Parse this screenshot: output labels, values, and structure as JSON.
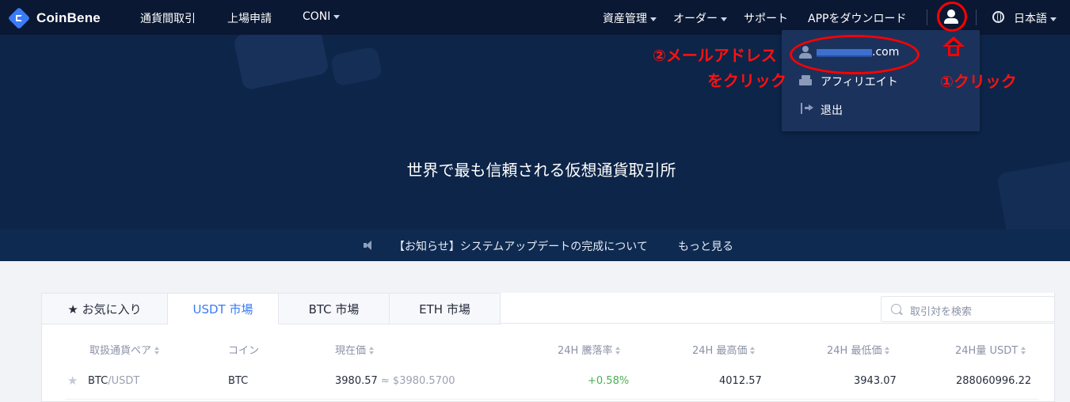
{
  "brand": {
    "name": "CoinBene"
  },
  "nav": {
    "items": [
      {
        "label": "通貨間取引",
        "dropdown": false
      },
      {
        "label": "上場申請",
        "dropdown": false
      },
      {
        "label": "CONI",
        "dropdown": true
      }
    ],
    "right": [
      {
        "label": "資産管理",
        "dropdown": true
      },
      {
        "label": "オーダー",
        "dropdown": true
      },
      {
        "label": "サポート",
        "dropdown": false
      },
      {
        "label": "APPをダウンロード",
        "dropdown": false
      }
    ],
    "language": "日本語"
  },
  "dropdown": {
    "email_suffix": ".com",
    "items": [
      {
        "label": "アフィリエイト",
        "icon": "affiliate-icon"
      },
      {
        "label": "退出",
        "icon": "logout-icon"
      }
    ]
  },
  "annotations": {
    "step1": "①クリック",
    "step2_line1": "②メールアドレス",
    "step2_line2": "をクリック",
    "color": "#ff0000"
  },
  "hero": {
    "title": "世界で最も信頼される仮想通貨取引所"
  },
  "notice": {
    "text": "【お知らせ】システムアップデートの完成について",
    "more": "もっと見る"
  },
  "market": {
    "tabs": [
      {
        "label": "★ お気に入り",
        "active": false
      },
      {
        "label": "USDT 市場",
        "active": true
      },
      {
        "label": "BTC 市場",
        "active": false
      },
      {
        "label": "ETH 市場",
        "active": false
      }
    ],
    "search_placeholder": "取引対を検索",
    "columns": [
      "取扱通貨ペア",
      "コイン",
      "現在価",
      "24H 騰落率",
      "24H 最高価",
      "24H 最低価",
      "24H量 USDT"
    ],
    "rows": [
      {
        "base": "BTC",
        "quote": "/USDT",
        "coin": "BTC",
        "price": "3980.57",
        "price_usd": "≈ $3980.5700",
        "change": "+0.58%",
        "high": "4012.57",
        "low": "3943.07",
        "volume": "288060996.22"
      }
    ]
  },
  "colors": {
    "nav_bg": "#0b1833",
    "hero_bg": "#0d2548",
    "accent": "#3a7bf6",
    "up": "#4caf50"
  }
}
